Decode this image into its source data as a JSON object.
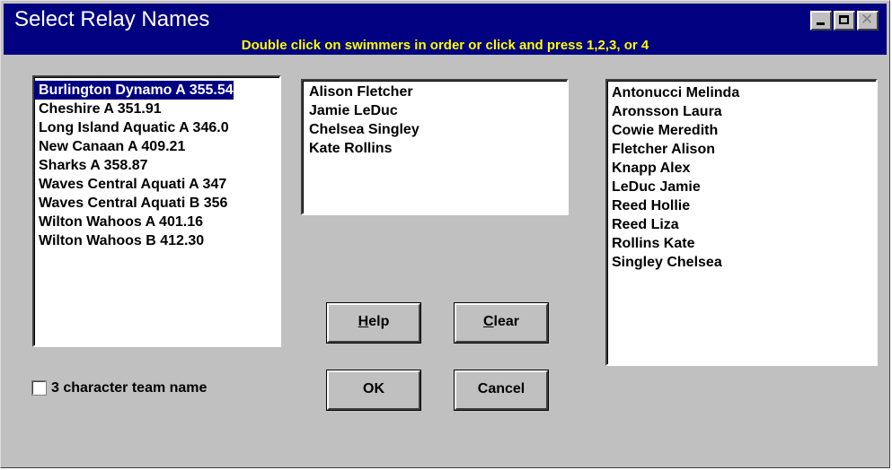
{
  "window": {
    "title": "Select Relay Names",
    "instruction": "Double click on swimmers in order or click and press 1,2,3, or 4"
  },
  "teams": {
    "items": [
      "Burlington Dynamo A  355.54",
      "Cheshire A  351.91",
      "Long Island Aquatic A  346.0",
      "New Canaan A  409.21",
      "Sharks A  358.87",
      "Waves Central Aquati A  347",
      "Waves Central Aquati B  356",
      "Wilton Wahoos A  401.16",
      "Wilton Wahoos B  412.30"
    ],
    "selected_index": 0
  },
  "relay": {
    "items": [
      "Alison Fletcher",
      "Jamie LeDuc",
      "Chelsea Singley",
      "Kate Rollins"
    ]
  },
  "swimmers": {
    "items": [
      "Antonucci Melinda",
      "Aronsson Laura",
      "Cowie Meredith",
      "Fletcher Alison",
      "Knapp Alex",
      "LeDuc Jamie",
      "Reed Hollie",
      "Reed Liza",
      "Rollins Kate",
      "Singley Chelsea"
    ]
  },
  "buttons": {
    "help_mnemonic": "H",
    "help_rest": "elp",
    "clear_mnemonic": "C",
    "clear_rest": "lear",
    "ok": "OK",
    "cancel": "Cancel"
  },
  "options": {
    "three_char_label": "3 character team name",
    "three_char_checked": false
  },
  "titlebar_icons": [
    "minimize-icon",
    "maximize-icon",
    "close-icon"
  ],
  "colors": {
    "title_bg": "#000080",
    "instruction_text": "#ffff00",
    "selection_bg": "#000080",
    "face": "#c0c0c0"
  }
}
